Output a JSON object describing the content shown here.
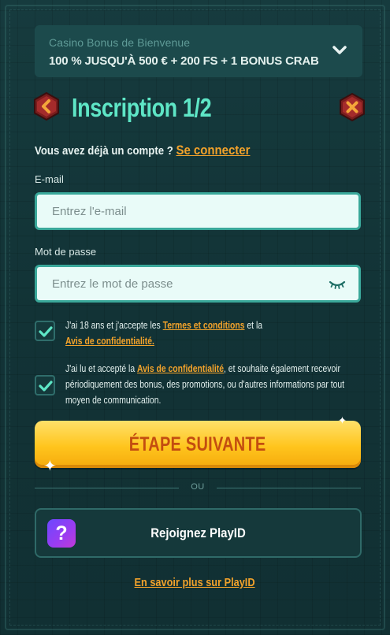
{
  "bonus": {
    "label": "Casino Bonus de Bienvenue",
    "value": "100 % JUSQU'À 500 € + 200 FS + 1 BONUS CRAB"
  },
  "header": {
    "title": "Inscription 1/2"
  },
  "login": {
    "prompt": "Vous avez déjà un compte ?",
    "link": "Se connecter"
  },
  "email": {
    "label": "E-mail",
    "placeholder": "Entrez l'e-mail",
    "value": ""
  },
  "password": {
    "label": "Mot de passe",
    "placeholder": "Entrez le mot de passe",
    "value": ""
  },
  "consents": [
    {
      "checked": true,
      "text_before": "J'ai 18 ans et j'accepte les ",
      "link1": "Termes et conditions",
      "text_middle": " et la ",
      "link2": "Avis de confidentialité.",
      "text_after": ""
    },
    {
      "checked": true,
      "text_before": "J'ai lu et accepté la ",
      "link1": "Avis de confidentialité",
      "text_after": ", et souhaite également recevoir périodiquement des bonus, des promotions, ou d'autres informations par tout moyen de communication."
    }
  ],
  "next_button": "ÉTAPE SUIVANTE",
  "divider_text": "OU",
  "playid": {
    "logo_glyph": "?",
    "label": "Rejoignez PlayID",
    "learn_more": "En savoir plus sur PlayID"
  },
  "colors": {
    "accent_teal": "#5ee6c6",
    "link_orange": "#f2a22b",
    "button_yellow": "#ffc51d",
    "button_text": "#c34d10"
  }
}
